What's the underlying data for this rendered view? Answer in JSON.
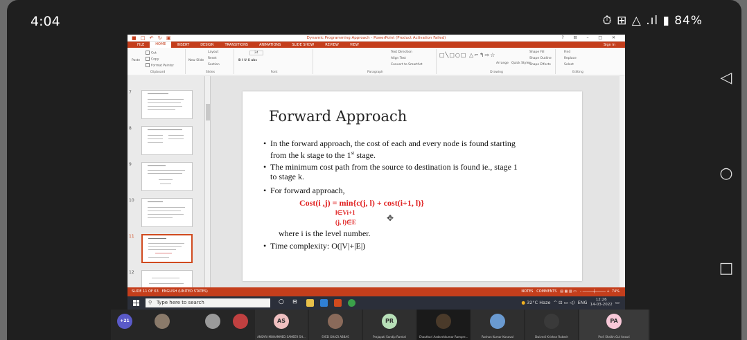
{
  "android": {
    "time": "4:04",
    "status_icons": "⏱ ⊞ △ .ıl ▮ 84%",
    "nav_back": "◁",
    "nav_home": "○",
    "nav_recents": "□"
  },
  "powerpoint": {
    "quick_access": "■ □ ↶ ↻ ▣",
    "window_title": "Dynamic Programming Approach - PowerPoint (Product Activation Failed)",
    "window_controls": "? ⊟ – □ ✕",
    "tabs": [
      "FILE",
      "HOME",
      "INSERT",
      "DESIGN",
      "TRANSITIONS",
      "ANIMATIONS",
      "SLIDE SHOW",
      "REVIEW",
      "VIEW"
    ],
    "active_tab": "HOME",
    "sign_in": "Sign in",
    "ribbon": {
      "clipboard": {
        "paste": "Paste",
        "cut": "Cut",
        "copy": "Copy",
        "format_painter": "Format Painter",
        "label": "Clipboard"
      },
      "slides": {
        "new_slide": "New Slide",
        "layout": "Layout",
        "reset": "Reset",
        "section": "Section",
        "label": "Slides"
      },
      "font": {
        "size": "24",
        "label": "Font"
      },
      "paragraph": {
        "text_direction": "Text Direction",
        "align_text": "Align Text",
        "convert": "Convert to SmartArt",
        "label": "Paragraph"
      },
      "drawing": {
        "arrange": "Arrange",
        "quick_styles": "Quick Styles",
        "shape_fill": "Shape Fill",
        "shape_outline": "Shape Outline",
        "shape_effects": "Shape Effects",
        "label": "Drawing"
      },
      "editing": {
        "find": "Find",
        "replace": "Replace",
        "select": "Select",
        "label": "Editing"
      }
    },
    "thumbnails": [
      {
        "num": "7"
      },
      {
        "num": "8"
      },
      {
        "num": "9"
      },
      {
        "num": "10"
      },
      {
        "num": "11"
      },
      {
        "num": "12"
      }
    ],
    "slide": {
      "title": "Forward Approach",
      "bullet1": "In the forward approach, the cost of each and every node is found starting from the k stage to the 1st stage.",
      "bullet2": "The minimum cost path from the source to destination is found ie., stage 1 to stage k.",
      "bullet3": "For forward approach,",
      "formula": "Cost(i ,j) = min{c(j, l) + cost(i+1, l)}",
      "cond1": "l∈Vi+1",
      "cond2": "(j, l)∈E",
      "where": "where i is the level number.",
      "bullet4": "Time complexity: O(|V|+|E|)"
    },
    "status": {
      "slide_info": "SLIDE 11 OF 63",
      "language": "ENGLISH (UNITED STATES)",
      "notes": "NOTES",
      "comments": "COMMENTS",
      "zoom": "74%"
    }
  },
  "taskbar": {
    "search_placeholder": "Type here to search",
    "weather": "32°C Haze",
    "lang": "ENG",
    "time": "12:26",
    "date": "14-03-2022"
  },
  "meet": {
    "more_count": "+21",
    "participants": [
      {
        "initials": "",
        "name": ""
      },
      {
        "initials": "",
        "name": ""
      },
      {
        "initials": "",
        "name": ""
      },
      {
        "initials": "AS",
        "name": "ANSARI MOHAMMED SAMEER SH..."
      },
      {
        "initials": "",
        "name": "SYED GHAZI ABBAS"
      },
      {
        "initials": "PR",
        "name": "Prajapati Sandip Ramlal"
      },
      {
        "initials": "",
        "name": "Chauthari Aadarshkumar Rampre..."
      },
      {
        "initials": "",
        "name": "Roshan Kumar Kanaval"
      },
      {
        "initials": "",
        "name": "Dwivedi Krishan Rakesh"
      },
      {
        "initials": "PA",
        "name": "Prof. Shaikh Gul Ansari"
      }
    ]
  }
}
